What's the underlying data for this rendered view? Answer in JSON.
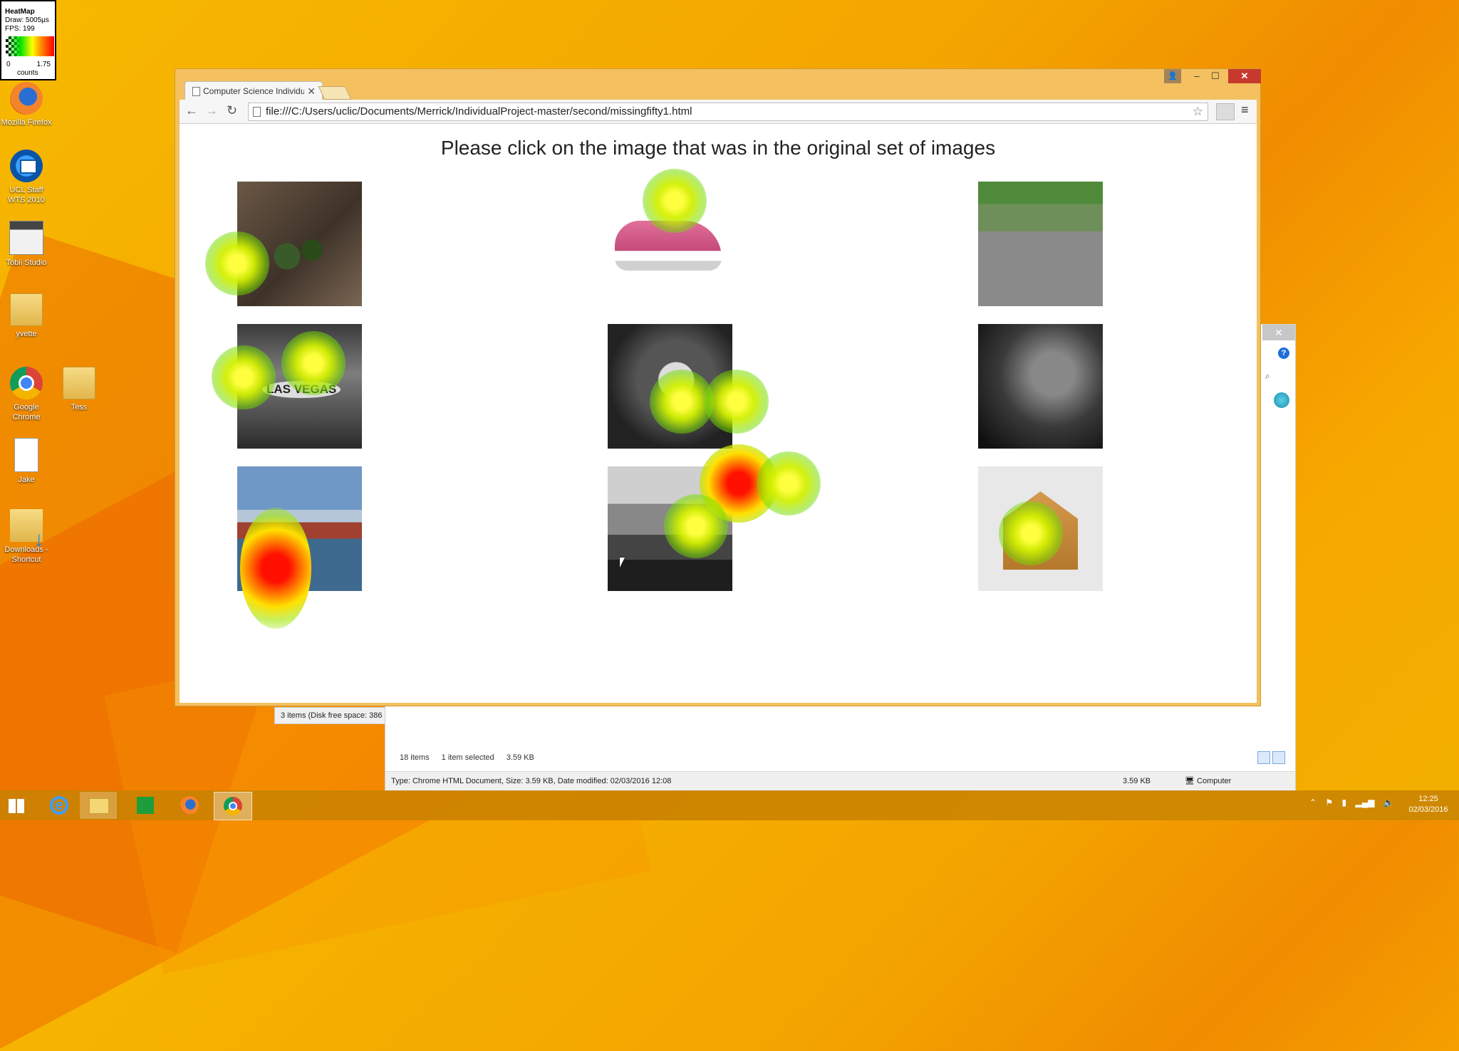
{
  "heatmap_legend": {
    "title": "HeatMap",
    "draw": "Draw: 5005µs",
    "fps": "FPS: 199",
    "min": "0",
    "max": "1.75",
    "units": "counts"
  },
  "desktop_icons": [
    {
      "label": "Mozilla Firefox",
      "icon": "firefox-icon"
    },
    {
      "label": "UCL Staff WTS 2010",
      "icon": "remote-desktop-icon"
    },
    {
      "label": "Tobii Studio",
      "icon": "tobii-studio-icon"
    },
    {
      "label": "yvette",
      "icon": "folder-icon"
    },
    {
      "label": "Google Chrome",
      "icon": "chrome-icon"
    },
    {
      "label": "Tess",
      "icon": "folder-icon"
    },
    {
      "label": "Jake",
      "icon": "document-icon"
    },
    {
      "label": "Downloads - Shortcut",
      "icon": "downloads-shortcut-icon"
    }
  ],
  "browser": {
    "tab_title": "Computer Science Individu",
    "url": "file:///C:/Users/uclic/Documents/Merrick/IndividualProject-master/second/missingfifty1.html",
    "page_heading": "Please click on the image that was in the original set of images",
    "images": [
      {
        "name": "frogs-image",
        "heat": "low"
      },
      {
        "name": "sneaker-image",
        "heat": "low"
      },
      {
        "name": "go-kart-image",
        "heat": "none"
      },
      {
        "name": "las-vegas-sign-image",
        "heat": "low"
      },
      {
        "name": "lemur-image",
        "heat": "low"
      },
      {
        "name": "leaf-droplets-image",
        "heat": "none"
      },
      {
        "name": "ship-image",
        "heat": "medium"
      },
      {
        "name": "lake-image",
        "heat": "high"
      },
      {
        "name": "gingerbread-house-image",
        "heat": "low"
      }
    ],
    "vegas_sign_text": "LAS VEGAS"
  },
  "explorer": {
    "status_left": "3 items (Disk free space: 386",
    "items_count": "18 items",
    "selected": "1 item selected",
    "selected_size": "3.59 KB",
    "details": "Type: Chrome HTML Document, Size: 3.59 KB, Date modified: 02/03/2016 12:08",
    "details_size": "3.59 KB",
    "location": "Computer"
  },
  "taskbar": {
    "time": "12:25",
    "date": "02/03/2016"
  },
  "colors": {
    "wallpaper": "#f3a400",
    "close_red": "#c7392d",
    "heat_high": "#ff1000",
    "heat_low": "#d2f000"
  }
}
